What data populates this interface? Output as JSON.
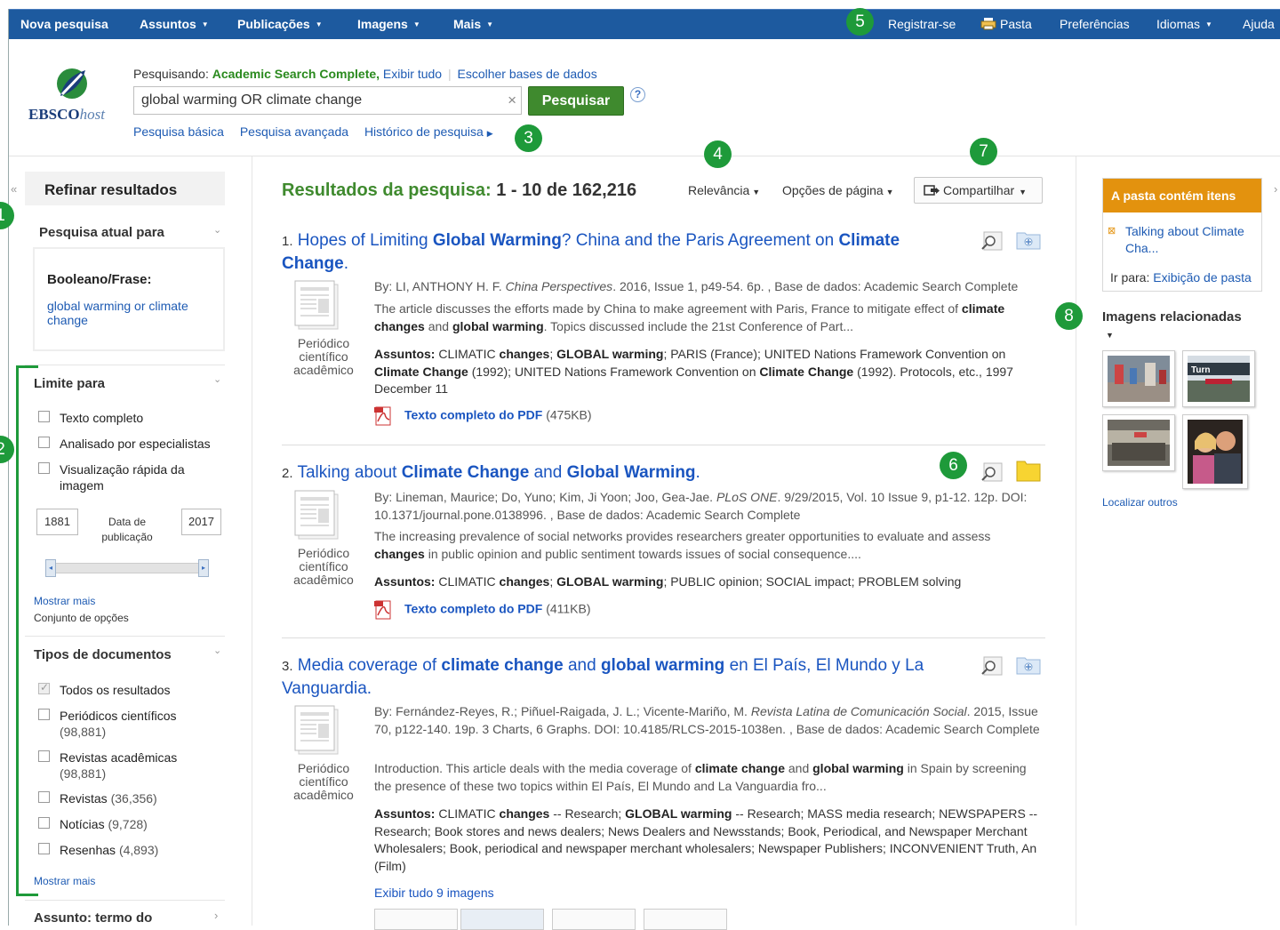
{
  "topnav": {
    "left": [
      "Nova pesquisa",
      "Assuntos",
      "Publicações",
      "Imagens",
      "Mais"
    ],
    "right": {
      "register": "Registrar-se",
      "folder": "Pasta",
      "prefs": "Preferências",
      "languages": "Idiomas",
      "help": "Ajuda"
    }
  },
  "badges": [
    "1",
    "2",
    "3",
    "4",
    "5",
    "6",
    "7",
    "8"
  ],
  "logo": {
    "brand_a": "EBSCO",
    "brand_b": "host"
  },
  "search": {
    "searching_label": "Pesquisando:",
    "database": "Academic Search Complete,",
    "show_all": "Exibir tudo",
    "choose_db": "Escolher bases de dados",
    "query": "global warming OR climate change",
    "clear": "×",
    "button": "Pesquisar",
    "help": "?",
    "basic": "Pesquisa básica",
    "advanced": "Pesquisa avançada",
    "history": "Histórico de pesquisa"
  },
  "sidebar": {
    "collapse": "«",
    "refine": "Refinar resultados",
    "current_search": "Pesquisa atual para",
    "boolean_label": "Booleano/Frase:",
    "boolean_value_1": "global warming or climate",
    "boolean_value_2": "change",
    "limit_to": "Limite para",
    "limits": [
      "Texto completo",
      "Analisado por especialistas",
      "Visualização rápida da",
      "imagem"
    ],
    "date_from": "1881",
    "date_to": "2017",
    "date_label_1": "Data de",
    "date_label_2": "publicação",
    "show_more": "Mostrar mais",
    "options_set": "Conjunto de opções",
    "doc_types": "Tipos de documentos",
    "doc_items": [
      {
        "label": "Todos os resultados",
        "checked": true
      },
      {
        "label": "Periódicos científicos",
        "count": "(98,881)"
      },
      {
        "label": "Revistas acadêmicas",
        "count": "(98,881)"
      },
      {
        "label": "Revistas",
        "count": "(36,356)"
      },
      {
        "label": "Notícias",
        "count": "(9,728)"
      },
      {
        "label": "Resenhas",
        "count": "(4,893)"
      }
    ],
    "show_more_2": "Mostrar mais",
    "subject": "Assunto: termo do"
  },
  "results": {
    "heading": "Resultados da pesquisa:",
    "range": "1 - 10 de 162,216",
    "sort": "Relevância",
    "page_options": "Opções de página",
    "share": "Compartilhar",
    "doctype_1": "Periódico",
    "doctype_2": "científico",
    "doctype_3": "acadêmico",
    "pdf_label": "Texto completo do PDF",
    "items": [
      {
        "num": "1.",
        "size": "(475KB)"
      },
      {
        "num": "2.",
        "size": "(411KB)"
      },
      {
        "num": "3.",
        "show_images": "Exibir tudo 9 imagens"
      }
    ]
  },
  "right": {
    "folder_head": "A pasta contém itens",
    "folder_item_1": "Talking about Climate",
    "folder_item_2": "Cha...",
    "goto": "Ir para:",
    "folder_view": "Exibição de pasta",
    "related": "Imagens relacionadas",
    "find_more": "Localizar outros",
    "expand": "›"
  },
  "colors": {
    "nav": "#1d5a9f",
    "green": "#1e9a3a",
    "link": "#1a55c0",
    "orange": "#e3920e"
  }
}
